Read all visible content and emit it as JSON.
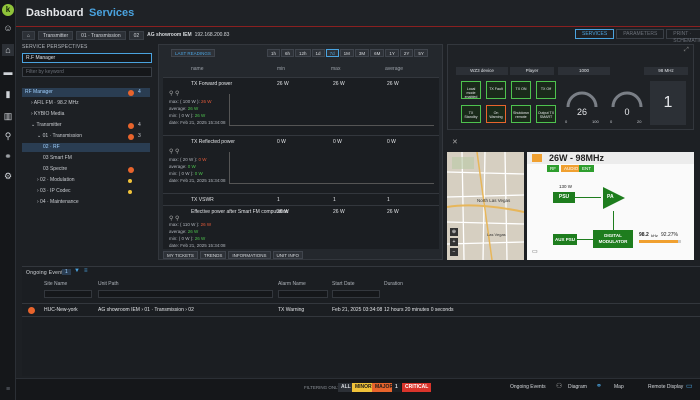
{
  "nav": {
    "logo": "k",
    "items": [
      "users-icon",
      "home-icon",
      "ticket-icon",
      "chart-icon",
      "pin-icon",
      "network-icon",
      "gear-icon"
    ]
  },
  "header": {
    "title": "Dashboard",
    "subtitle": "Services"
  },
  "breadcrumb": {
    "items": [
      "Transmitter",
      "01 · Transmission",
      "02"
    ],
    "device": "AG showroom IEM",
    "ip": "192.168.200.83"
  },
  "view_tabs": [
    {
      "label": "SERVICES",
      "active": true
    },
    {
      "label": "PARAMETERS",
      "active": false
    },
    {
      "label": "PRINT · SCHEMATIC",
      "active": false
    }
  ],
  "left": {
    "section_label": "SERVICE PERSPECTIVES",
    "perspective": "R.F Manager",
    "filter_placeholder": "Filter by keyword",
    "tree": [
      {
        "label": "RF Manager",
        "indent": 0,
        "badge": "4",
        "dot": "#e8642c",
        "sel": true
      },
      {
        "label": "› AFIL FM · 98.2 MHz",
        "indent": 1
      },
      {
        "label": "› KYBIO Media",
        "indent": 1
      },
      {
        "label": "⌄ Transmitter",
        "indent": 1,
        "badge": "4",
        "dot": "#e8642c"
      },
      {
        "label": "⌄ 01 · Transmission",
        "indent": 2,
        "badge": "3",
        "dot": "#e8642c"
      },
      {
        "label": "02 · RF",
        "indent": 3,
        "sel": true
      },
      {
        "label": "03 Smart FM",
        "indent": 3
      },
      {
        "label": "03 Spectre",
        "indent": 3,
        "dot": "#e8642c",
        "dot2": true
      },
      {
        "label": "› 02 · Modulation",
        "indent": 2,
        "dot": "#f0c23a",
        "small": true
      },
      {
        "label": "› 03 · IP Codec",
        "indent": 2,
        "dot": "#f0c23a",
        "small": true
      },
      {
        "label": "› 04 · Maintenance",
        "indent": 2
      }
    ]
  },
  "center": {
    "view_select": "LAST READINGS",
    "time_buttons": [
      "1h",
      "6h",
      "12h",
      "1d",
      "7d",
      "1M",
      "3M",
      "6M",
      "1Y",
      "2Y",
      "5Y"
    ],
    "columns": [
      "name",
      "min",
      "max",
      "average"
    ],
    "metrics": [
      {
        "name": "TX Forward power",
        "min": "26 W",
        "max": "26 W",
        "avg": "26 W",
        "stats": {
          "max": "max: ( 100 W ): ",
          "max_v": "26 W",
          "average": "average: ",
          "average_v": "26 W",
          "min": "min: ( 0 W ): ",
          "min_v": "26 W",
          "date": "date: Feb 21, 2025 15:34:08"
        }
      },
      {
        "name": "TX Reflected power",
        "min": "0 W",
        "max": "0 W",
        "avg": "0 W",
        "stats": {
          "max": "max: ( 20 W ): ",
          "max_v": "0 W",
          "average": "average: ",
          "average_v": "0 W",
          "min": "min: ( 0 W ): ",
          "min_v": "0 W",
          "date": "date: Feb 21, 2025 15:34:08"
        }
      },
      {
        "name": "TX VSWR",
        "min": "1",
        "max": "1",
        "avg": "1"
      },
      {
        "name": "Effective power after Smart FM computation",
        "min": "26 W",
        "max": "26 W",
        "avg": "26 W",
        "stats": {
          "max": "max: ( 110 W ): ",
          "max_v": "26 W",
          "average": "average: ",
          "average_v": "26 W",
          "min": "min: ( 0 W ): ",
          "min_v": "26 W",
          "date": "date: Feb 21, 2025 15:34:08"
        }
      }
    ],
    "footer_tabs": [
      "MY TICKETS",
      "TRENDS",
      "INFORMATIONS",
      "UNIT INFO"
    ]
  },
  "rtop": {
    "headers": [
      "WZ3 device",
      "Player",
      "1000",
      "98 MHz"
    ],
    "buttons": [
      "Local mode enabled",
      "TX Fault",
      "TX ON",
      "TX Off",
      "TX Standby",
      "On Warning",
      "Shutdown remote",
      "Output TX SMART"
    ],
    "gauges": [
      {
        "value": "26",
        "lo": "0",
        "hi": "100"
      },
      {
        "value": "0",
        "lo": "0",
        "hi": "20"
      }
    ],
    "counter": "1"
  },
  "map": {
    "city_label": "North Las Vegas",
    "city2": "Las Vegas"
  },
  "diagram": {
    "title": "26W - 98MHz",
    "tabs": [
      "RF",
      "AUDIO",
      "ENT"
    ],
    "power_label": "130 W",
    "psu": "PSU",
    "pa": "PA",
    "aux_psu": "AUX PSU",
    "modulator_line1": "DIGITAL",
    "modulator_line2": "MODULATOR",
    "freq": "98.2",
    "freq_unit": "kHz",
    "percent": "92.27%"
  },
  "events": {
    "label": "Ongoing Events",
    "count": "1",
    "columns": [
      "Site Name",
      "Unit Path",
      "Alarm Name",
      "Start Date",
      "Duration"
    ],
    "rows": [
      {
        "site": "HUC-New-york",
        "path": "AG showroom IEM › 01 · Transmission › 02",
        "alarm": "TX Warning",
        "start": "Feb 21, 2025 03:34:08",
        "duration": "12 hours 20 minutes 0 seconds",
        "color": "#e8642c"
      }
    ]
  },
  "footer": {
    "filter_label": "FILTERING ONLY",
    "severities": [
      {
        "label": "ALL",
        "bg": "#2c3036",
        "fg": "#d6d9dd"
      },
      {
        "label": "MINOR",
        "bg": "#f0c23a",
        "fg": "#1a1a1a"
      },
      {
        "label": "MAJOR",
        "bg": "#e8642c",
        "fg": "#1a1a1a"
      },
      {
        "label": "1",
        "bg": "#1d2024",
        "fg": "#d6d9dd"
      },
      {
        "label": "CRITICAL",
        "bg": "#d9342b",
        "fg": "#ffffff"
      }
    ],
    "links": [
      "Ongoing Events",
      "Diagram",
      "Map",
      "Remote Display"
    ]
  }
}
